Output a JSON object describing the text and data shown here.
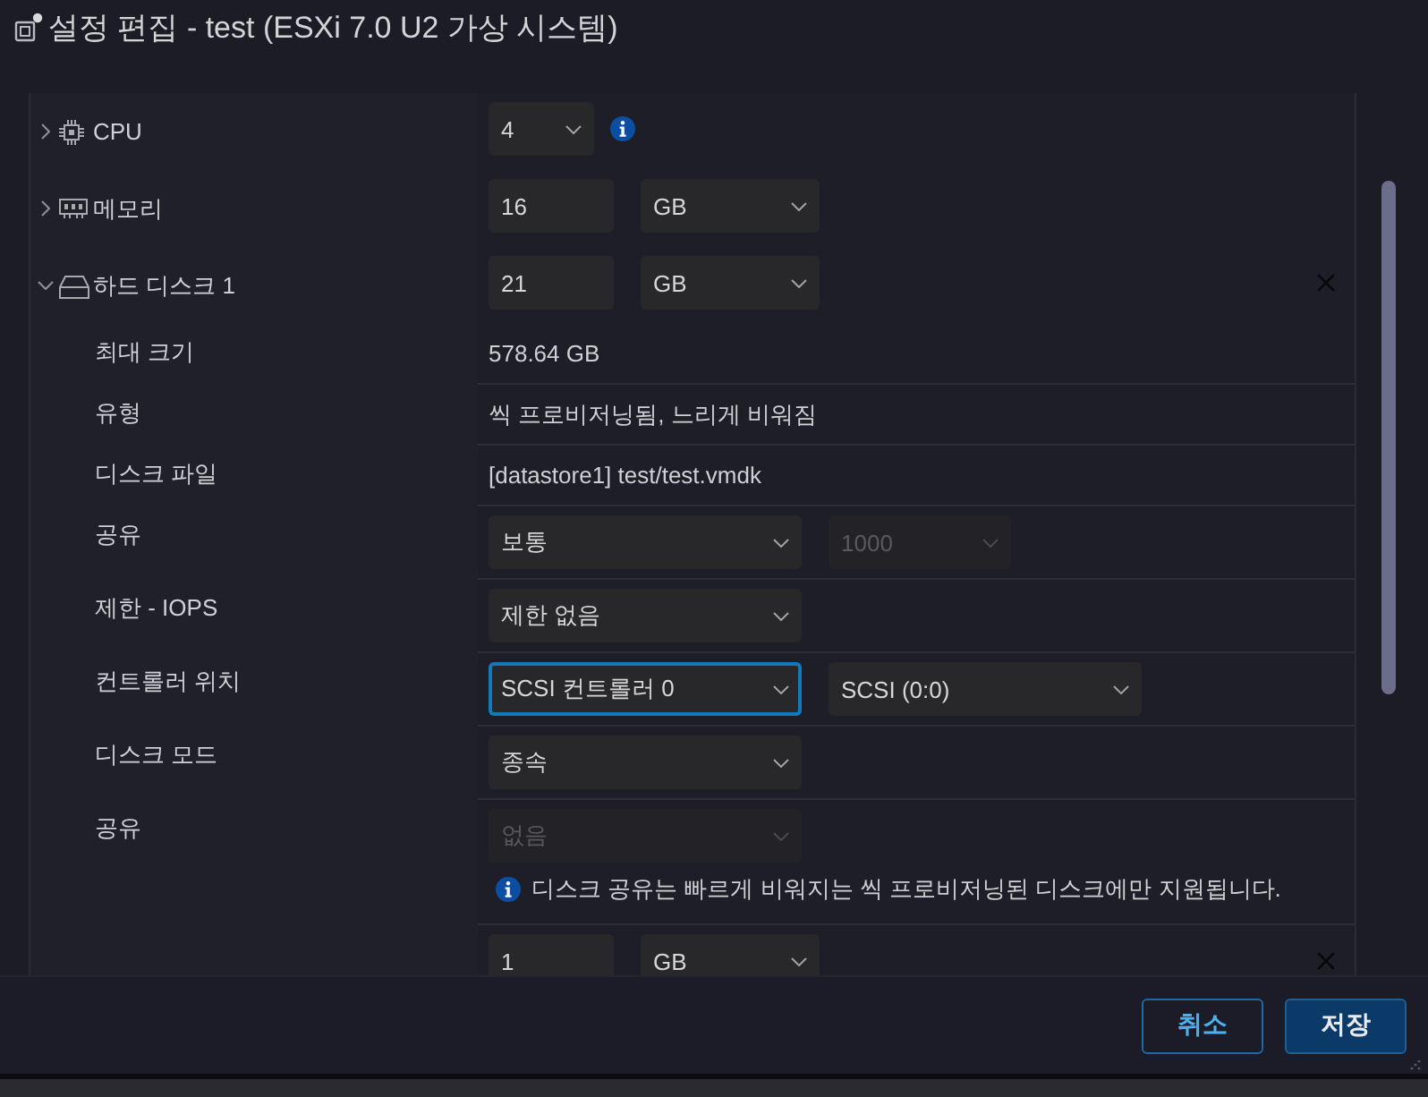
{
  "dialog": {
    "title": "설정 편집 - test (ESXi 7.0 U2 가상 시스템)"
  },
  "devices": [
    {
      "kind": "cpu",
      "label": "CPU",
      "expanded": false,
      "removable": false,
      "fields": [
        {
          "kind": "count-select",
          "value": "4",
          "disabled": false,
          "focused": false
        },
        {
          "kind": "info"
        }
      ]
    },
    {
      "kind": "memory",
      "label": "메모리",
      "expanded": false,
      "removable": false,
      "fields": [
        {
          "kind": "number-input",
          "value": "16",
          "disabled": false,
          "focused": false
        },
        {
          "kind": "unit-select",
          "value": "GB",
          "disabled": false,
          "focused": false
        }
      ]
    },
    {
      "kind": "disk",
      "label": "하드 디스크 1",
      "expanded": true,
      "removable": true,
      "fields": [
        {
          "kind": "number-input",
          "value": "21",
          "disabled": false,
          "focused": false
        },
        {
          "kind": "unit-select",
          "value": "GB",
          "disabled": false,
          "focused": false
        }
      ],
      "children": [
        {
          "label": "최대 크기",
          "fields": [
            {
              "kind": "text",
              "value": "578.64 GB"
            }
          ]
        },
        {
          "label": "유형",
          "fields": [
            {
              "kind": "text",
              "value": "씩 프로비저닝됨, 느리게 비워짐"
            }
          ]
        },
        {
          "label": "디스크 파일",
          "fields": [
            {
              "kind": "text",
              "value": "[datastore1] test/test.vmdk"
            }
          ]
        },
        {
          "label": "공유",
          "fields": [
            {
              "kind": "select",
              "value": "보통",
              "disabled": false,
              "focused": false
            },
            {
              "kind": "short-select",
              "value": "1000",
              "disabled": true,
              "focused": false
            }
          ]
        },
        {
          "label": "제한 - IOPS",
          "fields": [
            {
              "kind": "select",
              "value": "제한 없음",
              "disabled": false,
              "focused": false
            }
          ]
        },
        {
          "label": "컨트롤러 위치",
          "fields": [
            {
              "kind": "select",
              "value": "SCSI 컨트롤러 0",
              "disabled": false,
              "focused": true
            },
            {
              "kind": "select",
              "value": "SCSI (0:0)",
              "disabled": false,
              "focused": false
            }
          ]
        },
        {
          "label": "디스크 모드",
          "fields": [
            {
              "kind": "select",
              "value": "종속",
              "disabled": false,
              "focused": false
            }
          ]
        },
        {
          "label": "공유",
          "fields": [
            {
              "kind": "select",
              "value": "없음",
              "disabled": true,
              "focused": false
            }
          ],
          "note": "디스크 공유는 빠르게 비워지는 씩 프로비저닝된 디스크에만 지원됩니다."
        }
      ]
    },
    {
      "kind": "unlabeled",
      "removable": true,
      "fields": [
        {
          "kind": "number-input",
          "value": "1",
          "disabled": false,
          "focused": false
        },
        {
          "kind": "unit-select",
          "value": "GB",
          "disabled": false,
          "focused": false
        }
      ]
    }
  ],
  "buttons": [
    {
      "kind": "secondary",
      "label": "취소"
    },
    {
      "kind": "primary",
      "label": "저장"
    }
  ]
}
